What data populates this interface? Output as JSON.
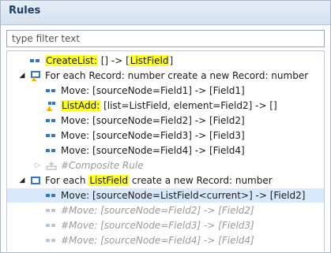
{
  "panel": {
    "title": "Rules"
  },
  "filter": {
    "placeholder": "type filter text",
    "value": ""
  },
  "tree": {
    "rows": [
      {
        "parts": [
          "",
          "CreateList:",
          " [] -> [",
          "ListField",
          "]"
        ]
      },
      {
        "text": "For each Record: number create a new Record: number"
      },
      {
        "text": "Move: [sourceNode=Field1] -> [Field1]"
      },
      {
        "parts": [
          "",
          "ListAdd:",
          " [list=ListField, element=Field2] -> []"
        ]
      },
      {
        "text": "Move: [sourceNode=Field2] -> [Field2]"
      },
      {
        "text": "Move: [sourceNode=Field3] -> [Field3]"
      },
      {
        "text": "Move: [sourceNode=Field4] -> [Field4]"
      },
      {
        "text": "#Composite Rule"
      },
      {
        "parts": [
          "For each ",
          "ListField",
          " create a new Record: number"
        ]
      },
      {
        "text": "Move: [sourceNode=ListField<current>] -> [Field2]"
      },
      {
        "text": "#Move: [sourceNode=Field2] -> [Field2]"
      },
      {
        "text": "#Move: [sourceNode=Field3] -> [Field3]"
      },
      {
        "text": "#Move: [sourceNode=Field4] -> [Field4]"
      }
    ]
  }
}
